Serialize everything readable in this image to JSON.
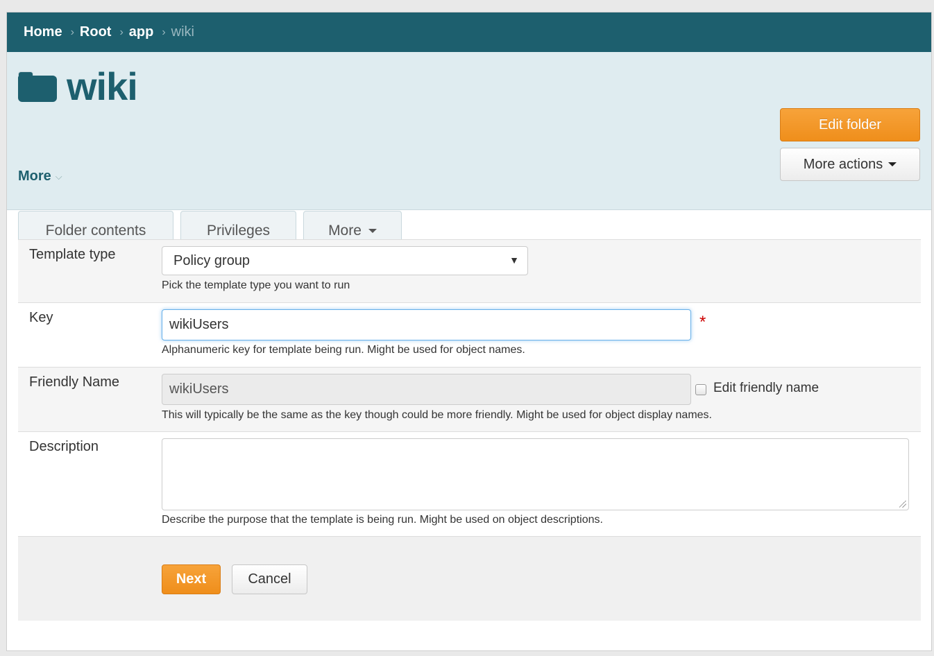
{
  "breadcrumb": {
    "items": [
      "Home",
      "Root",
      "app"
    ],
    "current": "wiki",
    "separator": ">"
  },
  "header": {
    "icon": "folder-icon",
    "title": "wiki",
    "more_label": "More",
    "edit_folder_label": "Edit folder",
    "more_actions_label": "More actions"
  },
  "tabs": [
    {
      "label": "Folder contents"
    },
    {
      "label": "Privileges"
    },
    {
      "label": "More"
    }
  ],
  "form": {
    "template_type": {
      "label": "Template type",
      "selected": "Policy group",
      "help": "Pick the template type you want to run"
    },
    "key": {
      "label": "Key",
      "value": "wikiUsers",
      "required_marker": "*",
      "help": "Alphanumeric key for template being run. Might be used for object names."
    },
    "friendly_name": {
      "label": "Friendly Name",
      "value": "wikiUsers",
      "checkbox_label": "Edit friendly name",
      "checked": false,
      "help": "This will typically be the same as the key though could be more friendly. Might be used for object display names."
    },
    "description": {
      "label": "Description",
      "value": "",
      "help": "Describe the purpose that the template is being run. Might be used on object descriptions."
    }
  },
  "actions": {
    "next_label": "Next",
    "cancel_label": "Cancel"
  },
  "colors": {
    "brand": "#1d5f6e",
    "accent": "#ef8e1b",
    "header_band": "#dfecf0"
  }
}
